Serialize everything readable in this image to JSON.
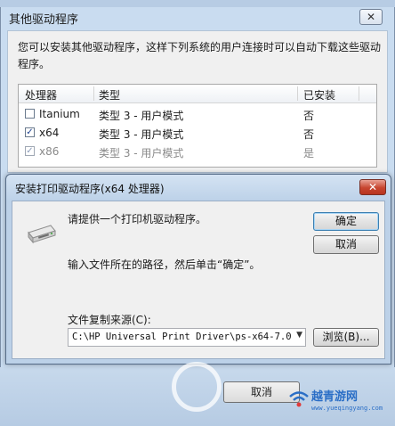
{
  "background_dialog": {
    "title": "其他驱动程序",
    "close_label": "✕",
    "description": "您可以安装其他驱动程序，这样下列系统的用户连接时可以自动下载这些驱动程序。",
    "columns": [
      "处理器",
      "类型",
      "已安装"
    ],
    "rows": [
      {
        "processor": "Itanium",
        "type": "类型 3 - 用户模式",
        "installed": "否",
        "checked": false
      },
      {
        "processor": "x64",
        "type": "类型 3 - 用户模式",
        "installed": "否",
        "checked": true
      },
      {
        "processor": "x86",
        "type": "类型 3 - 用户模式",
        "installed": "是",
        "checked": true
      }
    ],
    "bottom_button_label": "取消"
  },
  "install_dialog": {
    "title": "安装打印驱动程序(x64 处理器)",
    "close_label": "✕",
    "prompt": "请提供一个打印机驱动程序。",
    "instruction": "输入文件所在的路径，然后单击“确定”。",
    "copy_from_label": "文件复制来源(C):",
    "copy_from_value": "C:\\HP Universal Print Driver\\ps-x64-7.0.",
    "ok_label": "确定",
    "cancel_label": "取消",
    "browse_label": "浏览(B)..."
  },
  "icons": {
    "check": "✓",
    "dropdown": "▼"
  },
  "watermark": {
    "name": "越青游网",
    "url": "www.yueqingyang.com"
  }
}
